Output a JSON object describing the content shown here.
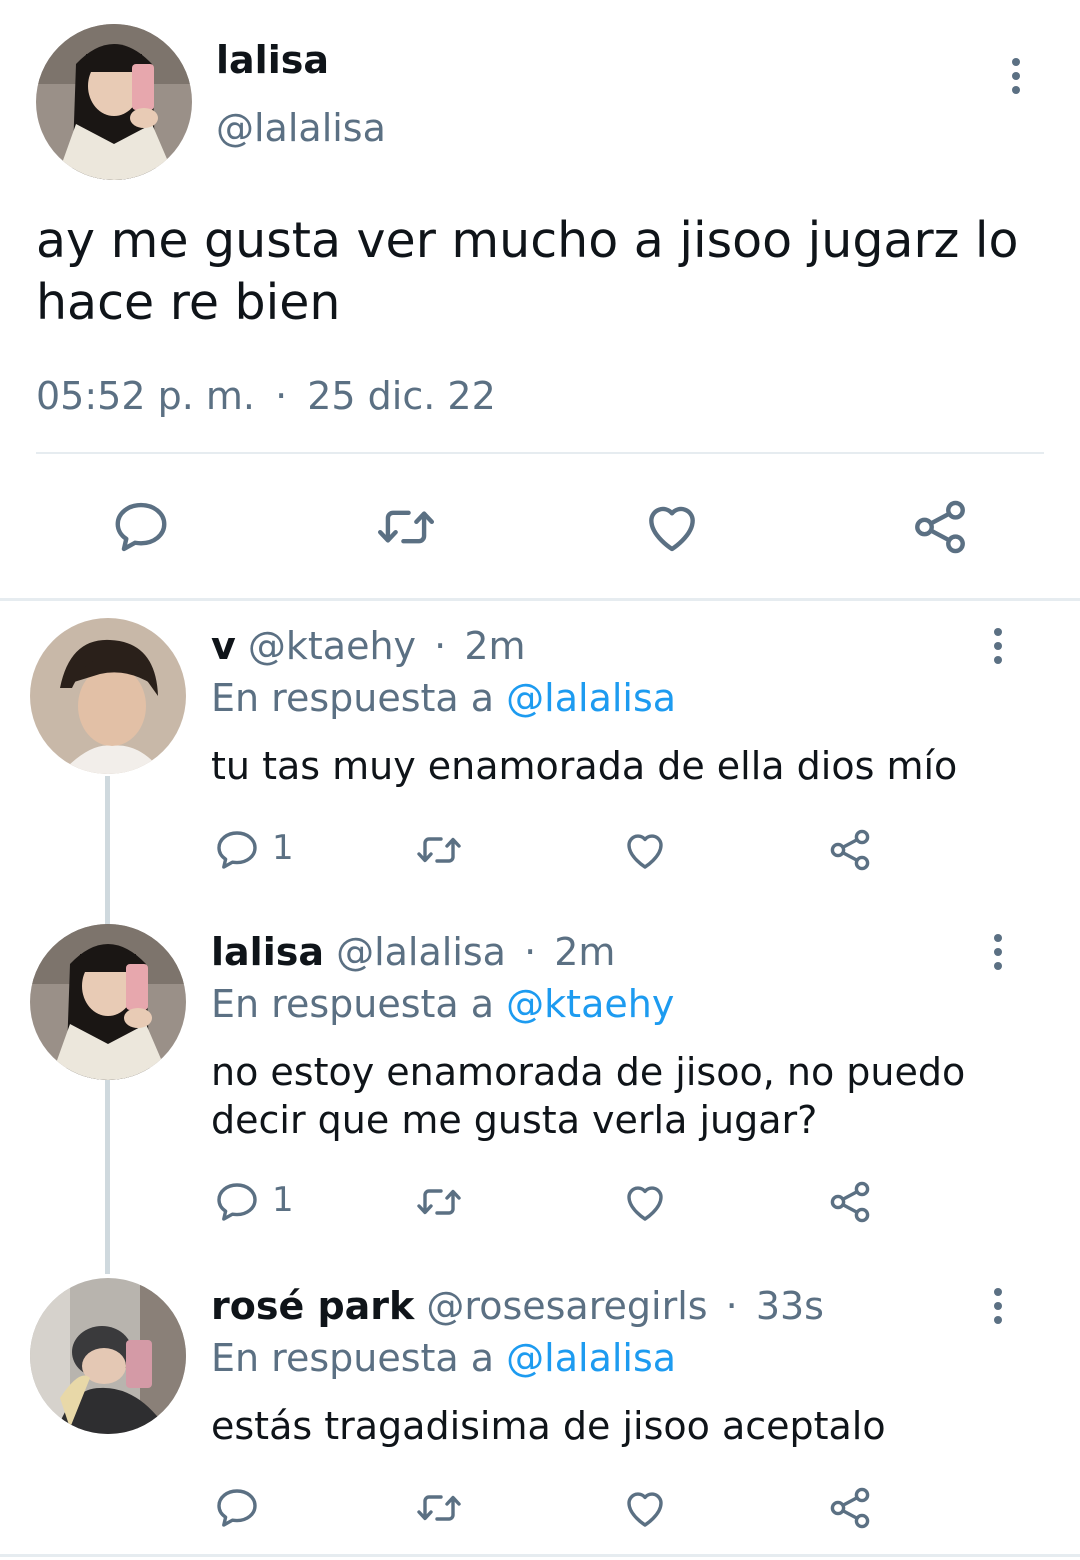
{
  "main_tweet": {
    "name": "lalisa",
    "handle": "@lalalisa",
    "text": "ay me gusta ver mucho a jisoo jugarz lo hace re bien",
    "time": "05:52 p. m.",
    "separator": "·",
    "date": "25 dic. 22"
  },
  "replies": [
    {
      "name": "v",
      "handle": "@ktaehy",
      "sep": "·",
      "time": "2m",
      "reply_prefix": "En respuesta a",
      "reply_to": "@lalalisa",
      "text": "tu tas muy enamorada de ella dios mío",
      "reply_count": "1"
    },
    {
      "name": "lalisa",
      "handle": "@lalalisa",
      "sep": "·",
      "time": "2m",
      "reply_prefix": "En respuesta a",
      "reply_to": "@ktaehy",
      "text": "no estoy enamorada de jisoo, no puedo decir que me gusta verla jugar?",
      "reply_count": "1"
    },
    {
      "name": "rosé park",
      "handle": "@rosesaregirls",
      "sep": "·",
      "time": "33s",
      "reply_prefix": "En respuesta a",
      "reply_to": "@lalalisa",
      "text": "estás tragadisima de jisoo aceptalo",
      "reply_count": ""
    }
  ],
  "icons": [
    "reply-icon",
    "retweet-icon",
    "like-icon",
    "share-icon",
    "more-icon"
  ],
  "colors": {
    "text": "#0f1419",
    "secondary": "#5b7083",
    "link": "#1d9bf0",
    "divider": "#e6ecf0",
    "thread_line": "#cfd9de"
  }
}
